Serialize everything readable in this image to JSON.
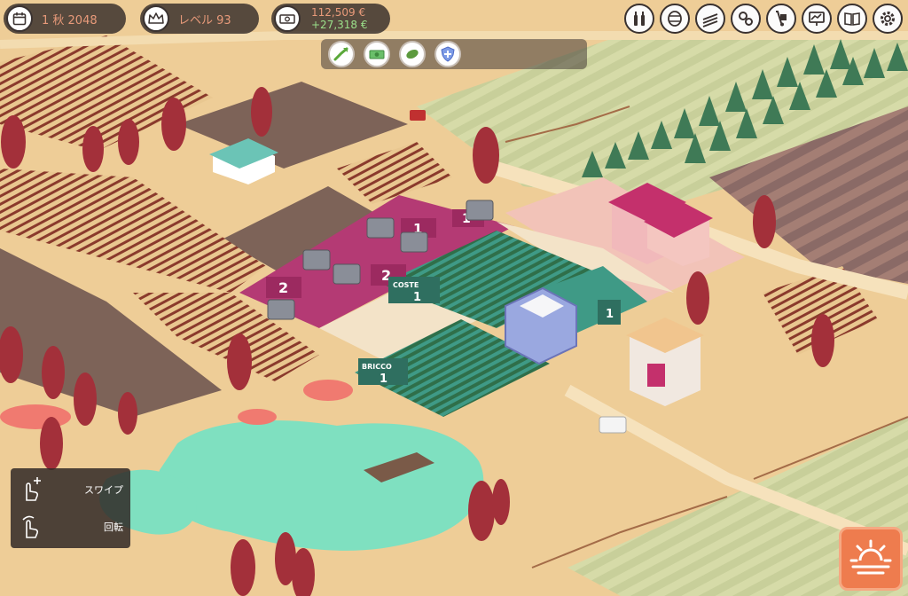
{
  "hud": {
    "date": "1 秋 2048",
    "level": "レベル 93",
    "money_total": "112,509 €",
    "money_delta": "+27,318 €",
    "date_icon": "calendar-icon",
    "level_icon": "crown-icon",
    "money_icon": "money-icon"
  },
  "menu": [
    {
      "name": "wines-icon"
    },
    {
      "name": "barrel-icon"
    },
    {
      "name": "vineyard-icon"
    },
    {
      "name": "gears-icon"
    },
    {
      "name": "hand-truck-icon"
    },
    {
      "name": "market-icon"
    },
    {
      "name": "book-icon"
    },
    {
      "name": "settings-icon"
    }
  ],
  "tray": [
    {
      "name": "growth-arrow-icon"
    },
    {
      "name": "cash-icon"
    },
    {
      "name": "leaf-icon"
    },
    {
      "name": "shield-icon"
    }
  ],
  "plots": {
    "winery_rooms": [
      "2",
      "2",
      "1",
      "1"
    ],
    "coste": {
      "name": "COSTE",
      "num": "1"
    },
    "bricco": {
      "name": "BRICCO",
      "num": "1"
    },
    "third": {
      "num": "1"
    }
  },
  "hints": {
    "swipe": "スワイプ",
    "rotate": "回転"
  },
  "colors": {
    "accent": "#ee7c4e",
    "hud_text": "#e89a7a",
    "money_up": "#9be08a",
    "winery_floor": "#b43a74",
    "vine_plot": "#3f9a86",
    "pond": "#7fe0c0"
  }
}
